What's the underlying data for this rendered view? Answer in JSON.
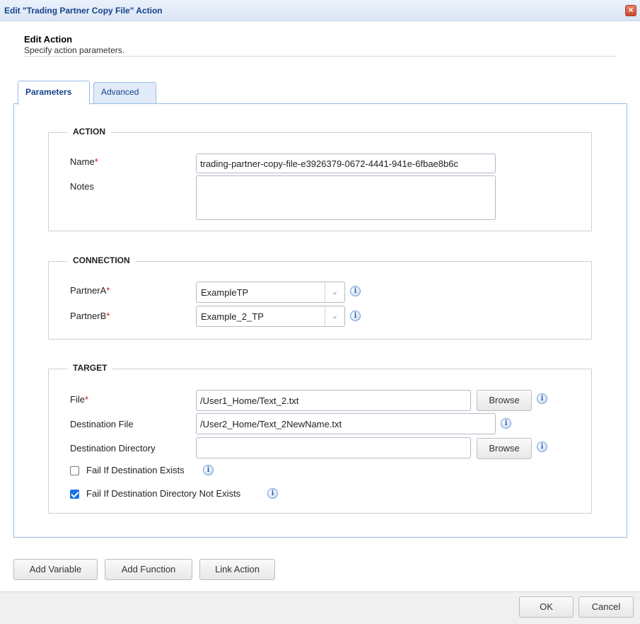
{
  "window": {
    "title": "Edit \"Trading Partner Copy File\" Action",
    "close_glyph": "×"
  },
  "header": {
    "title": "Edit Action",
    "subtitle": "Specify action parameters."
  },
  "tabs": [
    {
      "label": "Parameters",
      "active": true
    },
    {
      "label": "Advanced",
      "active": false
    }
  ],
  "action": {
    "legend": "ACTION",
    "name_label": "Name",
    "name_value": "trading-partner-copy-file-e3926379-0672-4441-941e-6fbae8b6c",
    "notes_label": "Notes",
    "notes_value": ""
  },
  "connection": {
    "legend": "CONNECTION",
    "partner_a_label": "PartnerA",
    "partner_a_value": "ExampleTP",
    "partner_b_label": "PartnerB",
    "partner_b_value": "Example_2_TP"
  },
  "target": {
    "legend": "TARGET",
    "file_label": "File",
    "file_value": "/User1_Home/Text_2.txt",
    "dest_file_label": "Destination File",
    "dest_file_value": "/User2_Home/Text_2NewName.txt",
    "dest_dir_label": "Destination Directory",
    "dest_dir_value": "",
    "browse_label": "Browse",
    "fail_if_exists_label": "Fail If Destination Exists",
    "fail_if_exists_checked": false,
    "fail_if_dir_not_exists_label": "Fail If Destination Directory Not Exists",
    "fail_if_dir_not_exists_checked": true
  },
  "required_marker": "*",
  "buttons": {
    "add_variable": "Add Variable",
    "add_function": "Add Function",
    "link_action": "Link Action",
    "ok": "OK",
    "cancel": "Cancel"
  },
  "icons": {
    "info": "info-icon",
    "dropdown": "chevron-down-icon",
    "close": "close-icon"
  }
}
